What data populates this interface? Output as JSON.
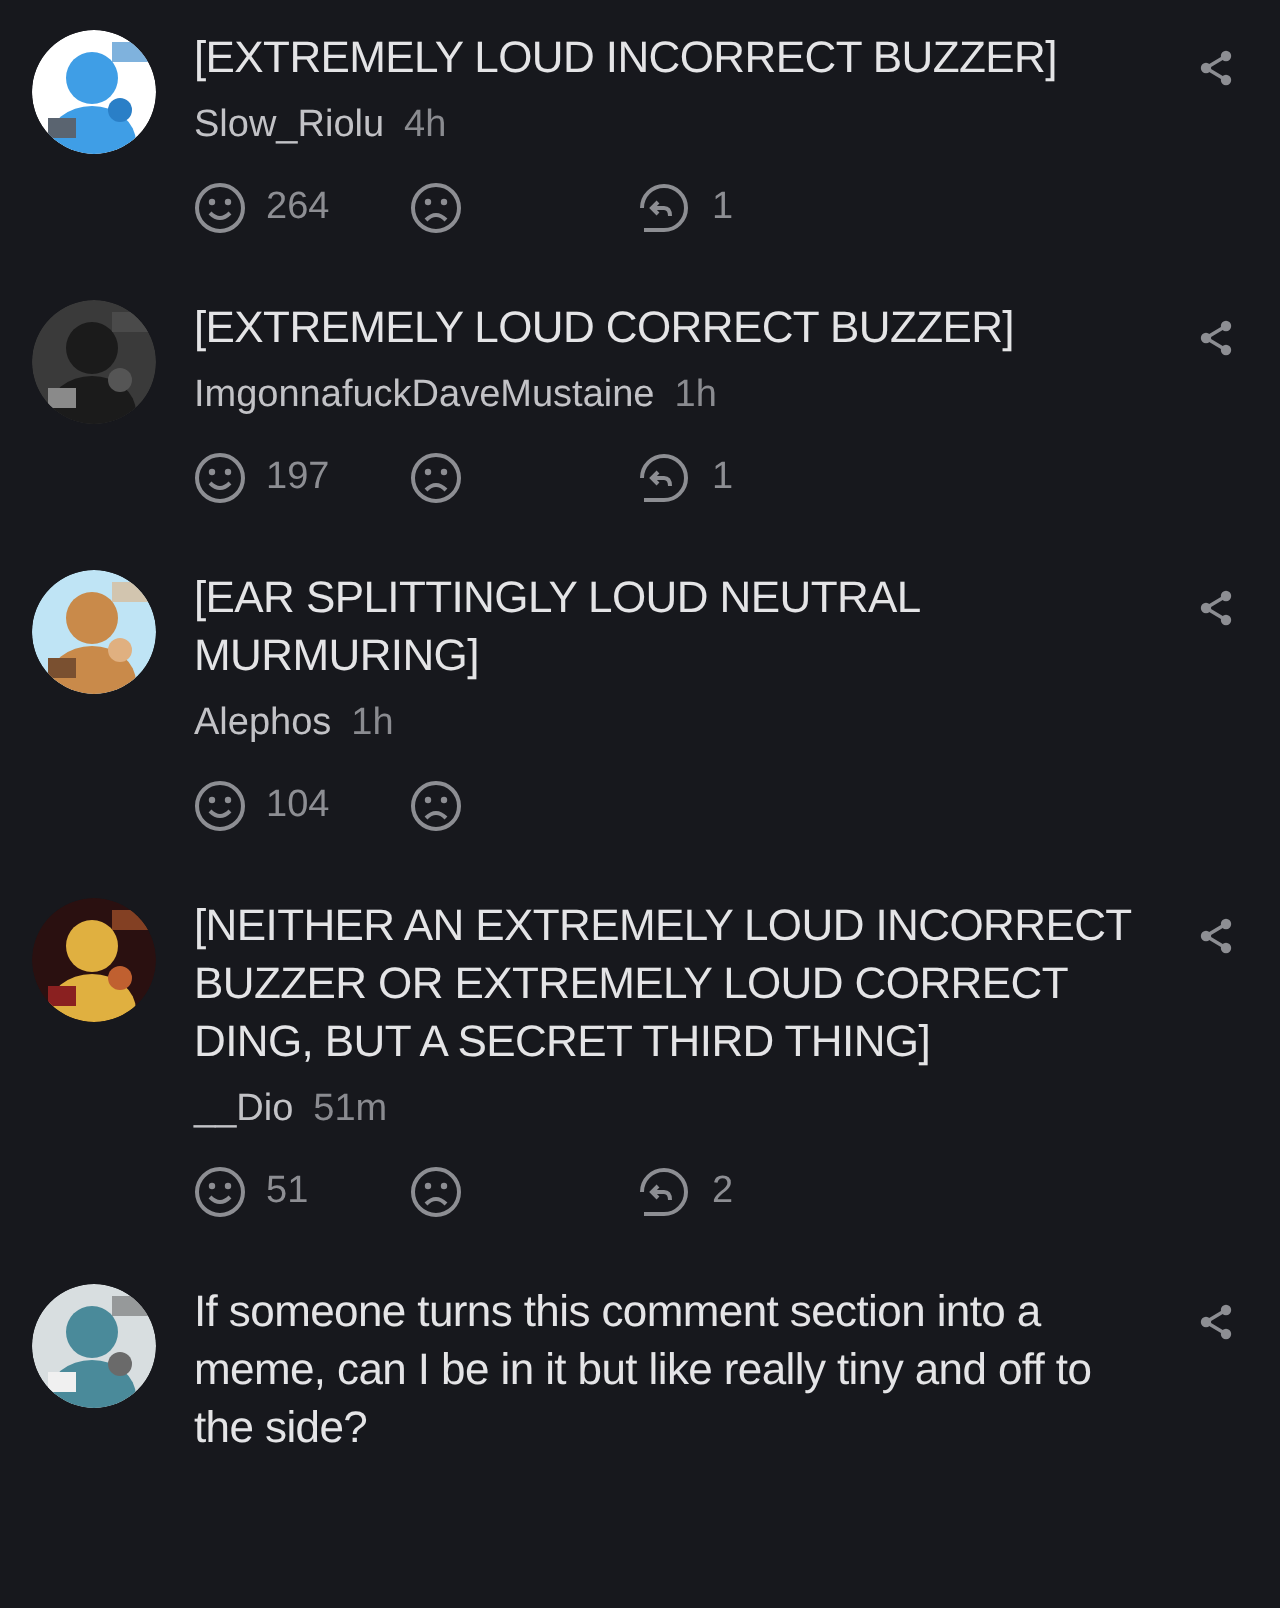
{
  "comments": [
    {
      "text": "[EXTREMELY LOUD INCORRECT BUZZER]",
      "username": "Slow_Riolu",
      "time": "4h",
      "likes": "264",
      "replies": "1"
    },
    {
      "text": "[EXTREMELY LOUD CORRECT BUZZER]",
      "username": "ImgonnafuckDaveMustaine",
      "time": "1h",
      "likes": "197",
      "replies": "1"
    },
    {
      "text": "[EAR SPLITTINGLY LOUD NEUTRAL MURMURING]",
      "username": "Alephos",
      "time": "1h",
      "likes": "104"
    },
    {
      "text": "[NEITHER AN EXTREMELY LOUD INCORRECT BUZZER OR EXTREMELY LOUD CORRECT DING, BUT A SECRET THIRD THING]",
      "username": "__Dio",
      "time": "51m",
      "likes": "51",
      "replies": "2"
    },
    {
      "text": "If someone turns this comment section into a meme, can I be in it but like really tiny and off to the side?"
    }
  ]
}
